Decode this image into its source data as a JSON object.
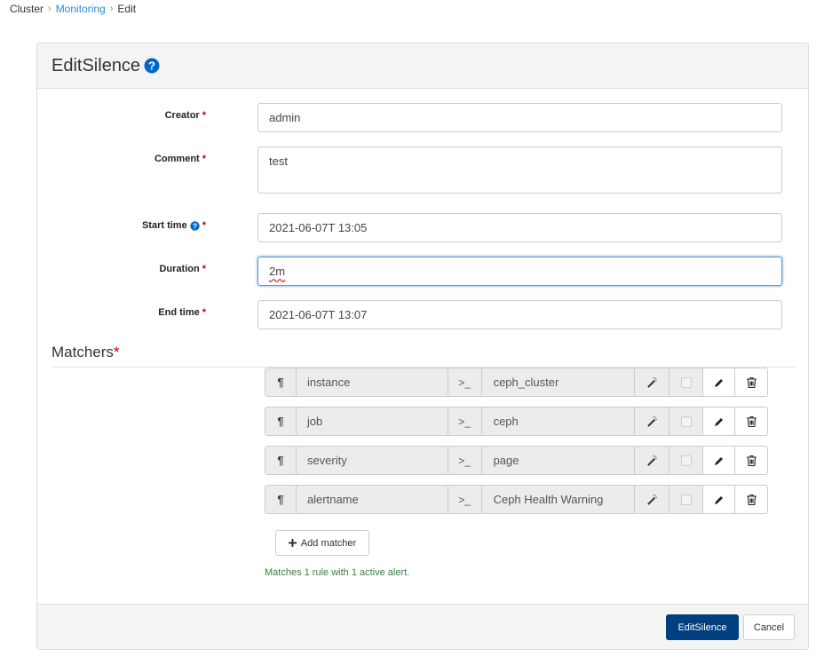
{
  "breadcrumb": [
    "Cluster",
    "Monitoring",
    "Edit"
  ],
  "title": "EditSilence",
  "form": {
    "creator": {
      "label": "Creator",
      "value": "admin"
    },
    "comment": {
      "label": "Comment",
      "value": "test"
    },
    "start_time": {
      "label": "Start time",
      "value": "2021-06-07T 13:05"
    },
    "duration": {
      "label": "Duration",
      "value": "2m"
    },
    "end_time": {
      "label": "End time",
      "value": "2021-06-07T 13:07"
    },
    "required_mark": "*"
  },
  "matchers": {
    "heading": "Matchers",
    "rows": [
      {
        "name": "instance",
        "operator": ">_",
        "value": "ceph_cluster",
        "regex": false
      },
      {
        "name": "job",
        "operator": ">_",
        "value": "ceph",
        "regex": false
      },
      {
        "name": "severity",
        "operator": ">_",
        "value": "page",
        "regex": false
      },
      {
        "name": "alertname",
        "operator": ">_",
        "value": "Ceph Health Warning",
        "regex": false
      }
    ],
    "add_label": "Add matcher",
    "status": "Matches 1 rule with 1 active alert."
  },
  "footer": {
    "submit": "EditSilence",
    "cancel": "Cancel"
  },
  "colors": {
    "primary": "#003f7f",
    "link": "#2b8ed8",
    "help": "#0066cc",
    "success": "#3c7d3c",
    "required": "#bb0000"
  }
}
